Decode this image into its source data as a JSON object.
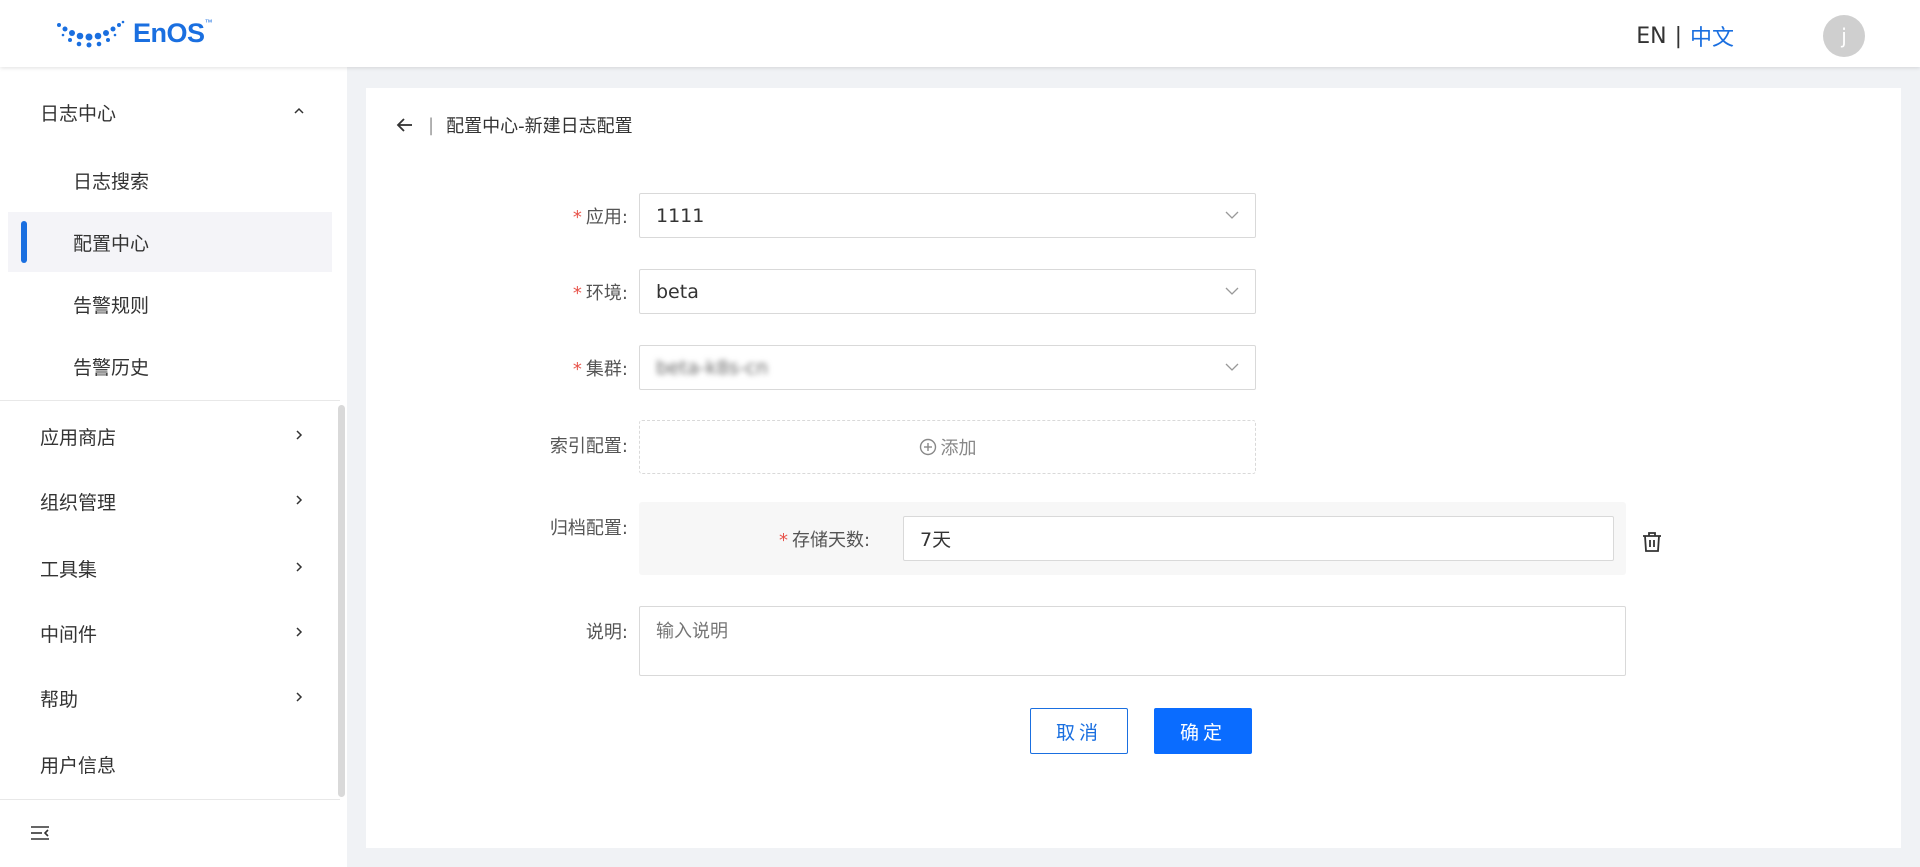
{
  "header": {
    "logo_text": "EnOS",
    "logo_tm": "™",
    "lang_en": "EN",
    "lang_sep": "|",
    "lang_zh": "中文",
    "avatar_letter": "j"
  },
  "sidebar": {
    "group_log": "日志中心",
    "items": [
      {
        "label": "日志搜索"
      },
      {
        "label": "配置中心"
      },
      {
        "label": "告警规则"
      },
      {
        "label": "告警历史"
      }
    ],
    "groups": [
      {
        "label": "应用商店"
      },
      {
        "label": "组织管理"
      },
      {
        "label": "工具集"
      },
      {
        "label": "中间件"
      },
      {
        "label": "帮助"
      }
    ],
    "user_info": "用户信息"
  },
  "page": {
    "title": "配置中心-新建日志配置"
  },
  "form": {
    "app_label": "应用:",
    "app_value": "1111",
    "env_label": "环境:",
    "env_value": "beta",
    "cluster_label": "集群:",
    "cluster_value": "beta-k8s-cn",
    "index_label": "索引配置:",
    "add_label": "添加",
    "archive_label": "归档配置:",
    "retention_label": "存储天数:",
    "retention_value": "7天",
    "desc_label": "说明:",
    "desc_placeholder": "输入说明",
    "cancel_label": "取消",
    "ok_label": "确定"
  },
  "colors": {
    "accent": "#1a6fe0",
    "primary_button": "#0a6cff",
    "required": "#e8534a"
  }
}
